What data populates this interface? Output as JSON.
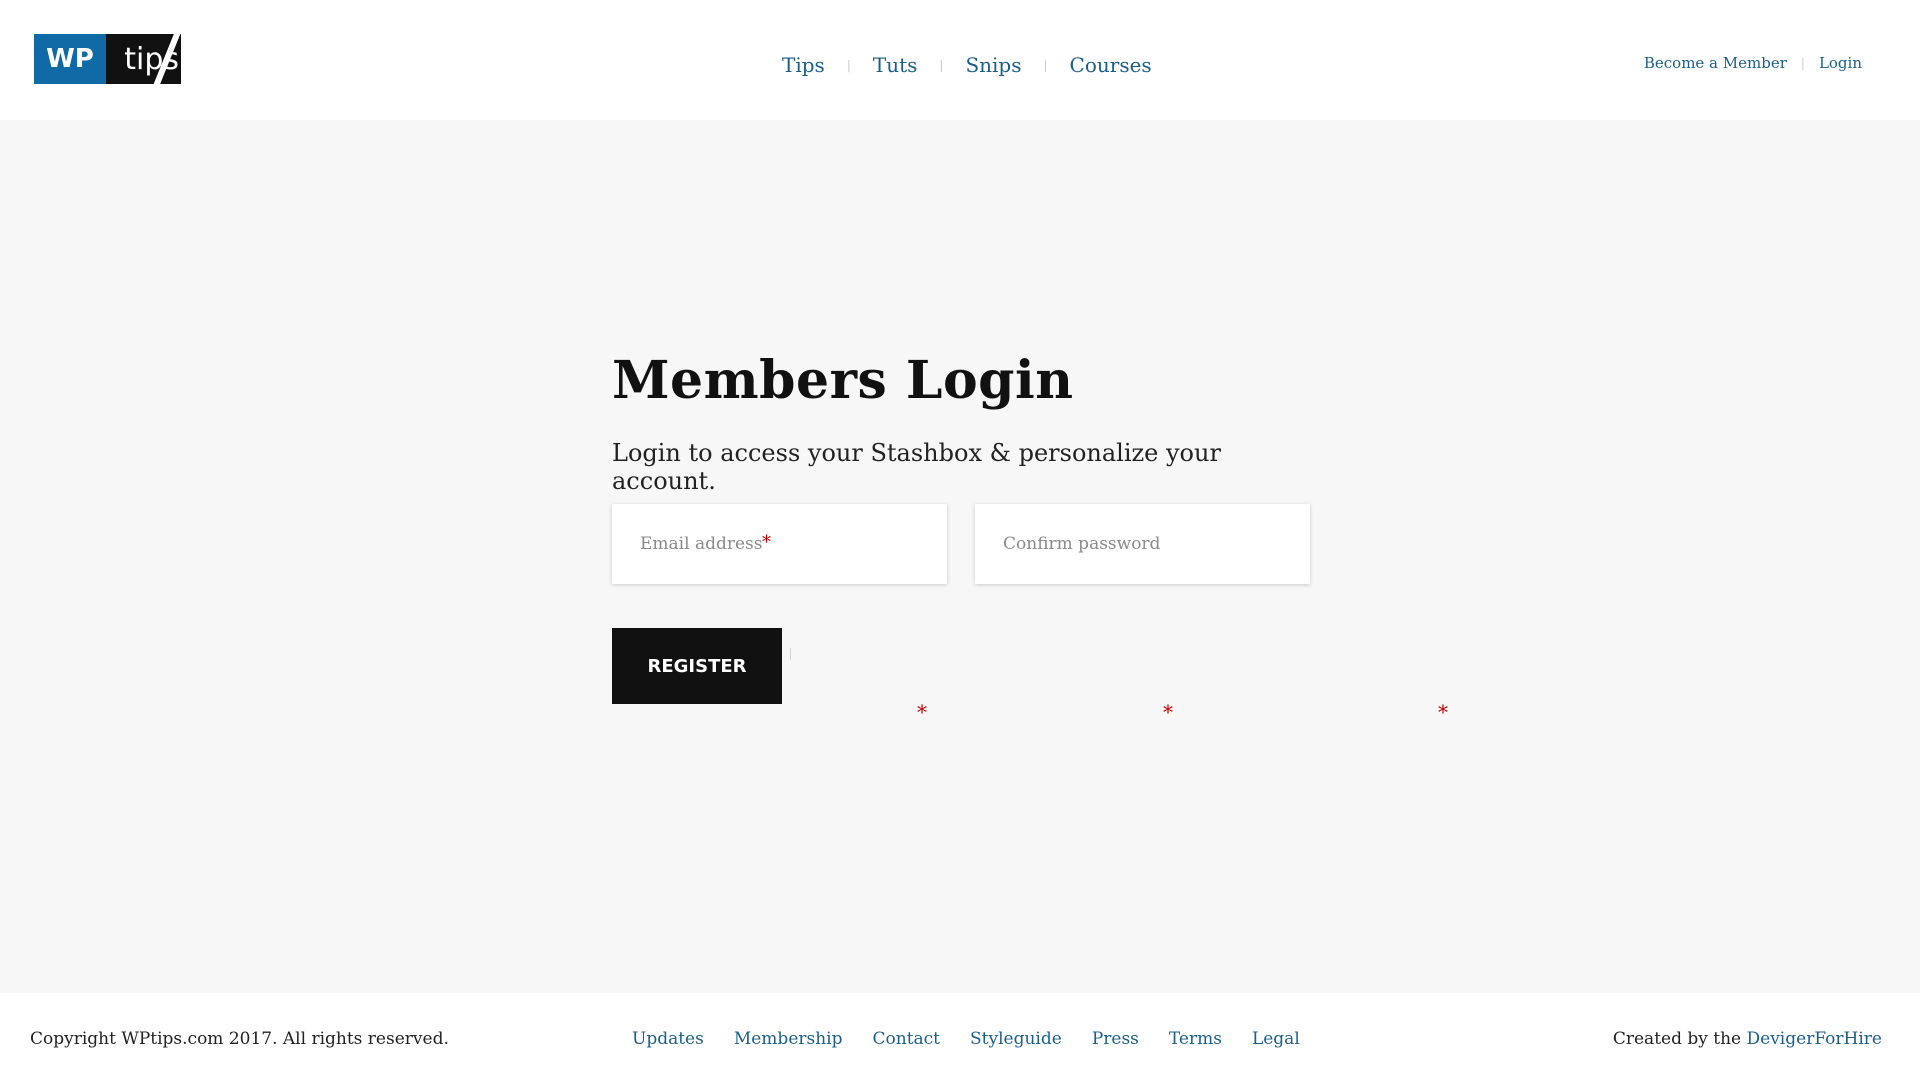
{
  "logo": {
    "wp": "WP",
    "tips": "tips"
  },
  "nav": {
    "items": [
      "Tips",
      "Tuts",
      "Snips",
      "Courses"
    ],
    "separator": "|"
  },
  "account": {
    "become_member": "Become a Member",
    "login": "Login",
    "separator": "|"
  },
  "main": {
    "title": "Members Login",
    "subtitle": "Login to access your Stashbox & personalize your account.",
    "email": {
      "placeholder": "Email address",
      "required_mark": "*"
    },
    "password": {
      "placeholder": "Confirm password"
    },
    "register_label": "REGISTER",
    "stray_required_mark": "*"
  },
  "footer": {
    "copyright": "Copyright WPtips.com 2017. All rights reserved.",
    "links": [
      "Updates",
      "Membership",
      "Contact",
      "Styleguide",
      "Press",
      "Terms",
      "Legal"
    ],
    "credit_prefix": "Created by the",
    "credit_link": "DevigerForHire"
  },
  "colors": {
    "link": "#1a5f8a",
    "brand_blue": "#0f6aa6",
    "dark": "#111111",
    "required": "#c40000",
    "background": "#f7f7f7"
  }
}
